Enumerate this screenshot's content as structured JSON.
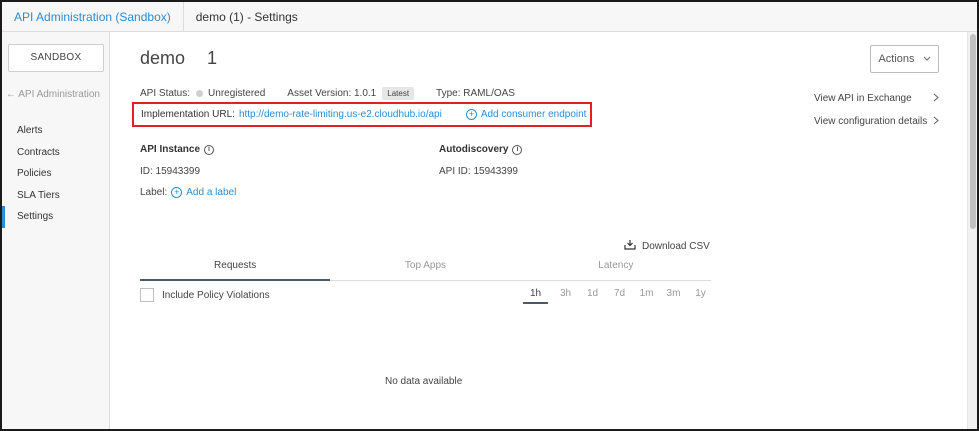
{
  "breadcrumb": {
    "root": "API Administration (Sandbox)",
    "current": "demo (1) - Settings"
  },
  "sidebar": {
    "environment": "SANDBOX",
    "back_link": "API Administration",
    "items": [
      {
        "label": "Alerts"
      },
      {
        "label": "Contracts"
      },
      {
        "label": "Policies"
      },
      {
        "label": "SLA Tiers"
      },
      {
        "label": "Settings",
        "active": true
      }
    ]
  },
  "header": {
    "api_name": "demo",
    "api_version": "1",
    "actions_label": "Actions"
  },
  "meta": {
    "status_label": "API Status:",
    "status_value": "Unregistered",
    "asset_version_label": "Asset Version: 1.0.1",
    "latest_badge": "Latest",
    "type_label": "Type: RAML/OAS"
  },
  "implementation": {
    "label": "Implementation URL:",
    "url": "http://demo-rate-limiting.us-e2.cloudhub.io/api",
    "add_endpoint": "Add consumer endpoint"
  },
  "right_links": {
    "exchange": "View API in Exchange",
    "config": "View configuration details"
  },
  "api_instance": {
    "title": "API Instance",
    "id_text": "ID: 15943399",
    "label_text": "Label:",
    "add_label": "Add a label"
  },
  "autodiscovery": {
    "title": "Autodiscovery",
    "id_text": "API ID: 15943399"
  },
  "analytics": {
    "download_label": "Download CSV",
    "tabs": [
      {
        "label": "Requests",
        "active": true
      },
      {
        "label": "Top Apps"
      },
      {
        "label": "Latency"
      }
    ],
    "policy_violations_label": "Include Policy Violations",
    "ranges": [
      "1h",
      "3h",
      "1d",
      "7d",
      "1m",
      "3m",
      "1y"
    ],
    "active_range": "1h",
    "no_data": "No data available"
  },
  "colors": {
    "link": "#2f8ccf",
    "highlight_border": "#e41e26"
  }
}
